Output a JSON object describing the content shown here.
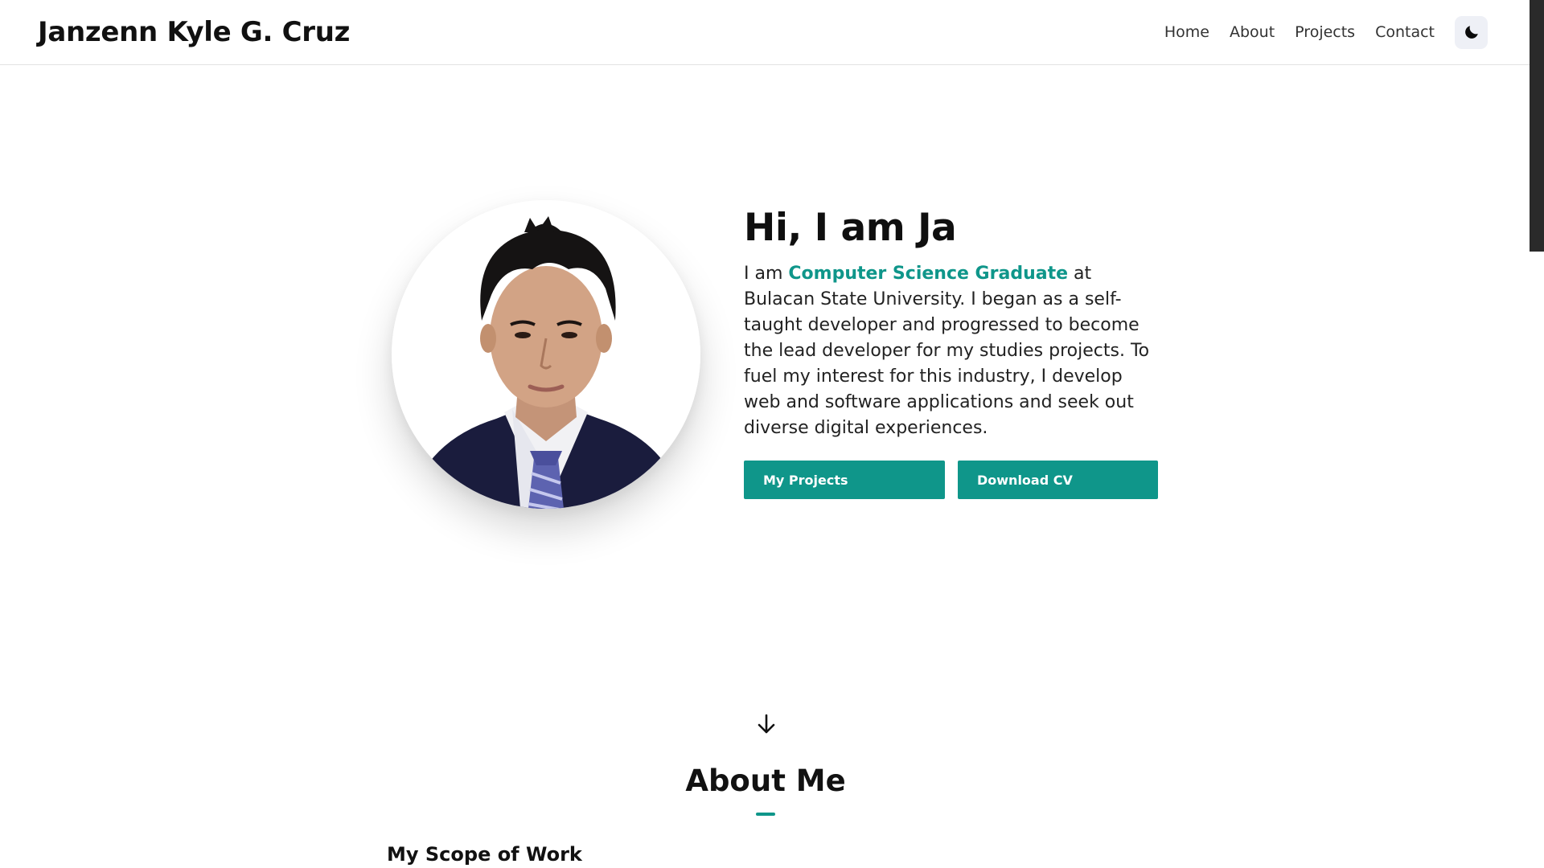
{
  "header": {
    "brand": "Janzenn Kyle G. Cruz",
    "nav": [
      {
        "label": "Home"
      },
      {
        "label": "About"
      },
      {
        "label": "Projects"
      },
      {
        "label": "Contact"
      }
    ],
    "theme_toggle_icon": "moon-icon"
  },
  "hero": {
    "title": "Hi, I am Ja",
    "intro_prefix": "I am ",
    "intro_highlight": "Computer Science Graduate",
    "intro_rest": " at Bulacan State University. I began as a self-taught developer and progressed to become the lead developer for my studies projects. To fuel my interest for this industry, I develop web and software applications and seek out diverse digital experiences.",
    "buttons": {
      "projects": "My Projects",
      "cv": "Download CV"
    }
  },
  "about": {
    "scroll_icon": "arrow-down-icon",
    "title": "About Me",
    "scope_title": "My Scope of Work"
  },
  "colors": {
    "accent": "#0f968a",
    "text": "#111111",
    "header_bg": "#ffffff",
    "toggle_bg": "#eef0f6"
  }
}
